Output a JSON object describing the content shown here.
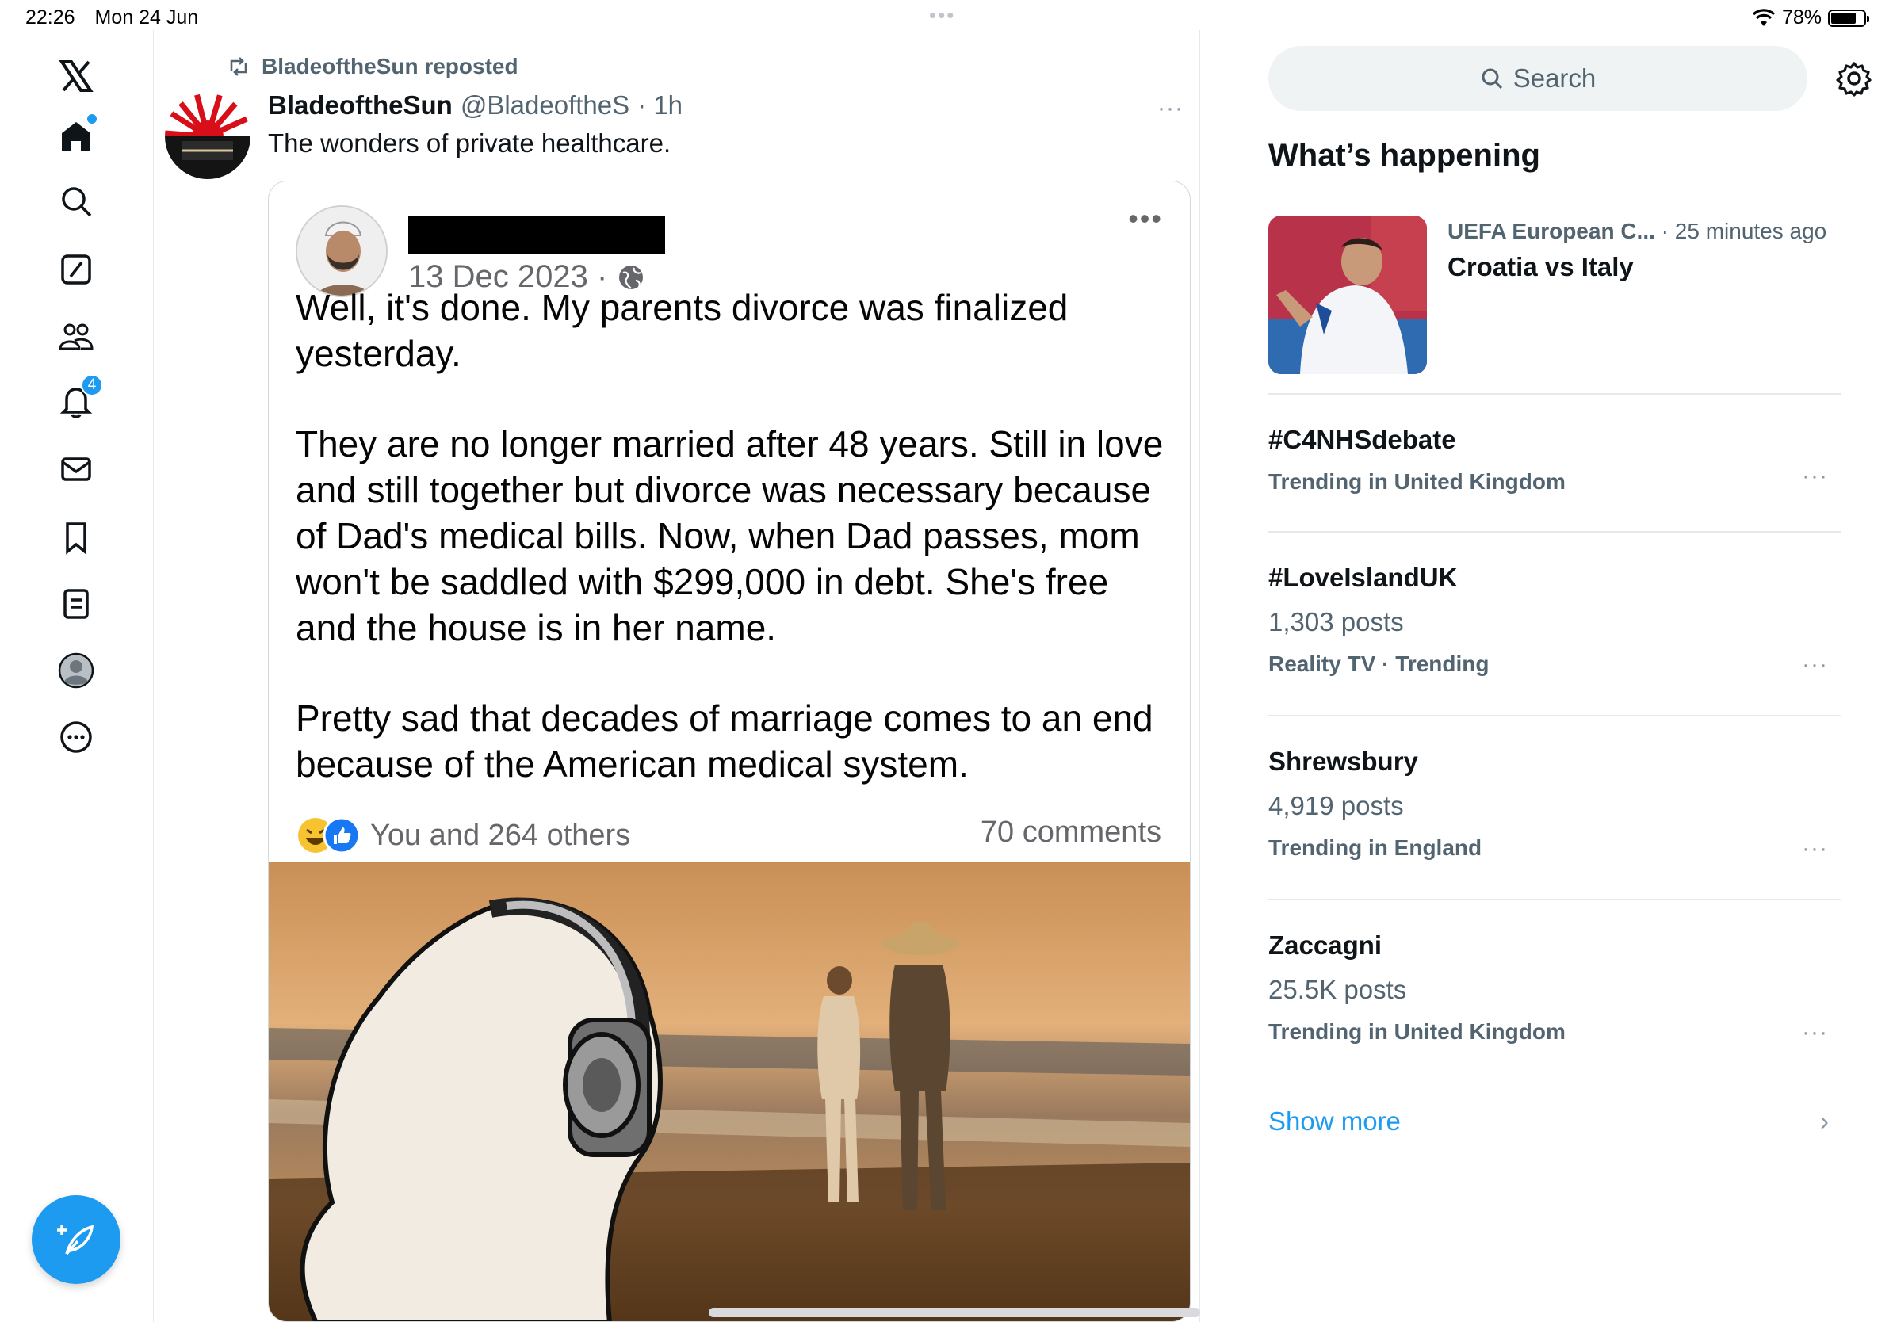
{
  "status_bar": {
    "time": "22:26",
    "date": "Mon 24 Jun",
    "battery": "78%",
    "battery_level": 0.78
  },
  "top_dots": "•••",
  "nav": {
    "items": [
      {
        "name": "home",
        "icon": "home-icon"
      },
      {
        "name": "explore",
        "icon": "search-icon"
      },
      {
        "name": "grok",
        "icon": "grok-icon"
      },
      {
        "name": "communities",
        "icon": "communities-icon"
      },
      {
        "name": "notifications",
        "icon": "bell-icon",
        "badge": "4"
      },
      {
        "name": "messages",
        "icon": "mail-icon"
      },
      {
        "name": "bookmarks",
        "icon": "bookmark-icon"
      },
      {
        "name": "lists",
        "icon": "list-icon"
      },
      {
        "name": "profile",
        "icon": "profile-icon"
      },
      {
        "name": "more",
        "icon": "more-circle-icon"
      }
    ]
  },
  "post": {
    "repost_text": "BladeoftheSun reposted",
    "display_name": "BladeoftheSun",
    "handle": "@BladeoftheS",
    "time": "· 1h",
    "more": "···",
    "text": "The wonders of private healthcare.",
    "media": {
      "date": "13 Dec 2023 ·",
      "dots": "•••",
      "paragraphs": [
        "Well, it's done. My parents divorce was finalized yesterday.",
        "They are no longer married after 48 years. Still in love and still together but divorce was necessary because of Dad's medical bills. Now, when Dad passes, mom won't be saddled with $299,000 in debt. She's free and the house is in her name.",
        "Pretty sad that decades of marriage comes to an end because of the American medical system."
      ],
      "reactions": "You and 264 others",
      "comments": "70 comments"
    }
  },
  "sidebar": {
    "search_placeholder": "Search",
    "section_title": "What’s happening",
    "news": {
      "source": "UEFA European C...",
      "time": "· 25 minutes ago",
      "title": "Croatia vs Italy"
    },
    "trends": [
      {
        "name": "#C4NHSdebate",
        "count": "",
        "context": "Trending in United Kingdom"
      },
      {
        "name": "#LoveIslandUK",
        "count": "1,303 posts",
        "context": "Reality TV · Trending"
      },
      {
        "name": "Shrewsbury",
        "count": "4,919 posts",
        "context": "Trending in England"
      },
      {
        "name": "Zaccagni",
        "count": "25.5K posts",
        "context": "Trending in United Kingdom"
      }
    ],
    "trend_more": "···",
    "show_more": "Show more",
    "chevron": "›"
  }
}
